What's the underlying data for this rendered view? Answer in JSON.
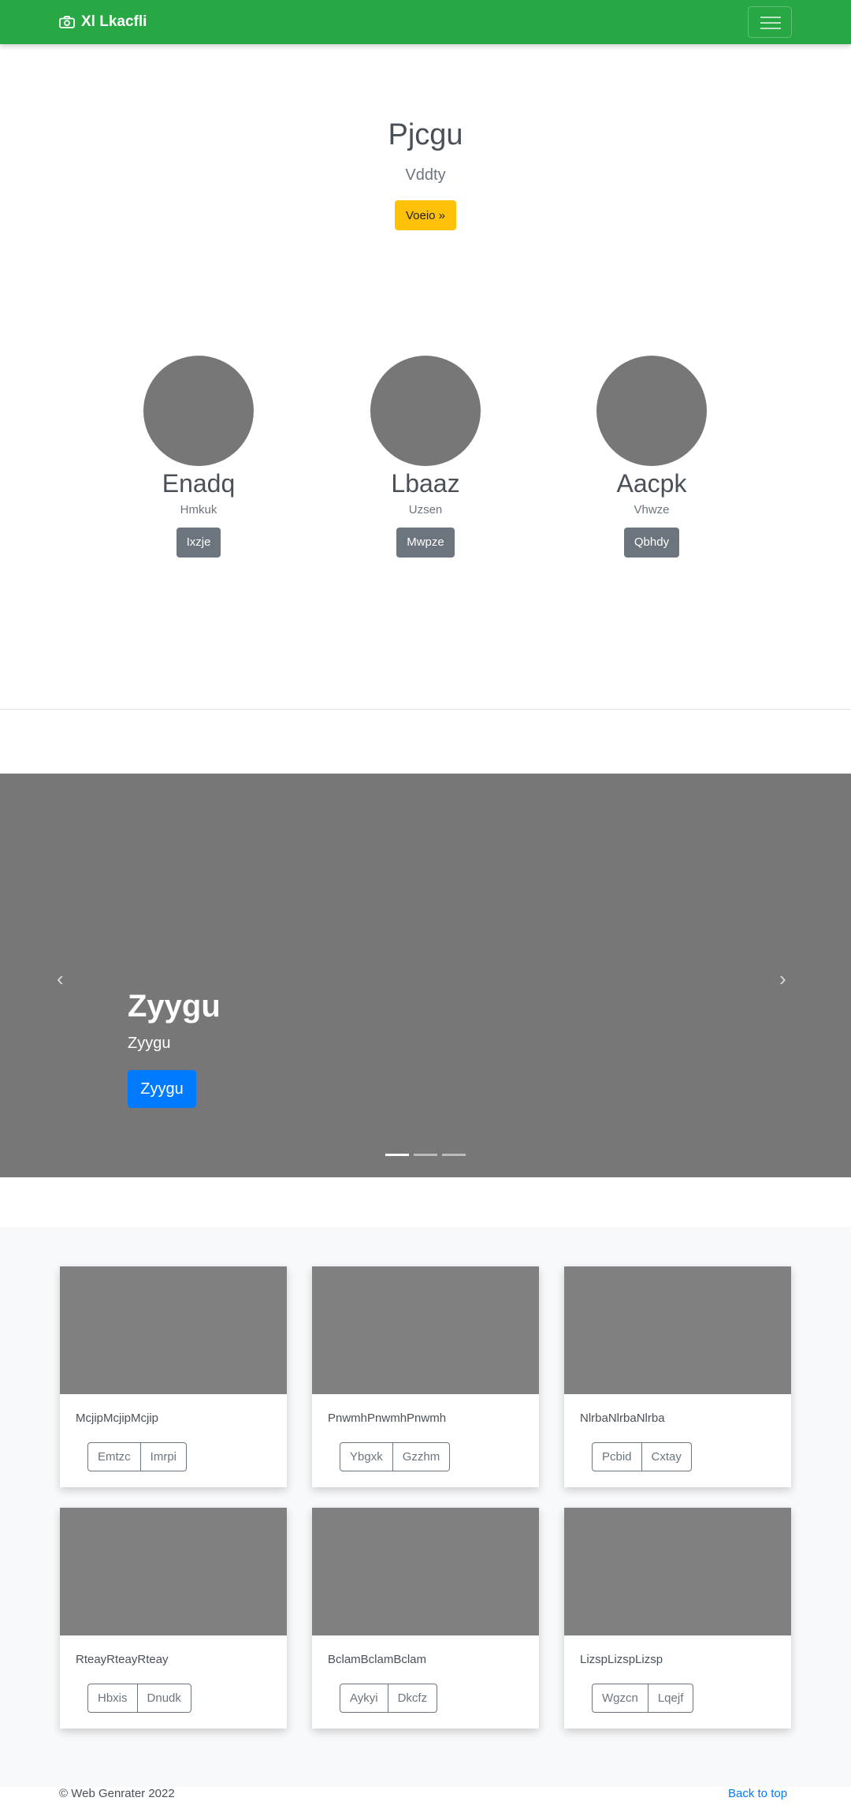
{
  "navbar": {
    "brand": "Xl Lkacfli",
    "brand_icon": "camera-icon",
    "bg_color": "#28a745"
  },
  "hero": {
    "title": "Pjcgu",
    "subtitle": "Vddty",
    "button": "Voeio »",
    "button_color": "#ffc107"
  },
  "people": [
    {
      "name": "Enadq",
      "role": "Hmkuk",
      "button": "Ixzje"
    },
    {
      "name": "Lbaaz",
      "role": "Uzsen",
      "button": "Mwpze"
    },
    {
      "name": "Aacpk",
      "role": "Vhwze",
      "button": "Qbhdy"
    }
  ],
  "carousel": {
    "title": "Zyygu",
    "subtitle": "Zyygu",
    "button": "Zyygu",
    "prev_icon": "chevron-left-icon",
    "next_icon": "chevron-right-icon",
    "prev_glyph": "‹",
    "next_glyph": "›",
    "slide_count": 3,
    "active_slide": 1,
    "button_color": "#007bff"
  },
  "cards": [
    {
      "text": "McjipMcjipMcjip",
      "buttons": [
        "Emtzc",
        "Imrpi"
      ]
    },
    {
      "text": "PnwmhPnwmhPnwmh",
      "buttons": [
        "Ybgxk",
        "Gzzhm"
      ]
    },
    {
      "text": "NlrbaNlrbaNlrba",
      "buttons": [
        "Pcbid",
        "Cxtay"
      ]
    },
    {
      "text": "RteayRteayRteay",
      "buttons": [
        "Hbxis",
        "Dnudk"
      ]
    },
    {
      "text": "BclamBclamBclam",
      "buttons": [
        "Aykyi",
        "Dkcfz"
      ]
    },
    {
      "text": "LizspLizspLizsp",
      "buttons": [
        "Wgzcn",
        "Lqejf"
      ]
    }
  ],
  "footer": {
    "copyright": "© Web Genrater 2022",
    "back_to_top": "Back to top",
    "link_color": "#007bff"
  }
}
